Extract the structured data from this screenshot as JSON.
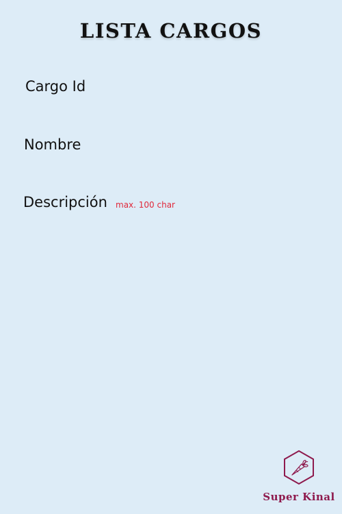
{
  "header": {
    "title": "LISTA CARGOS"
  },
  "form": {
    "fields": [
      {
        "label": "Cargo Id"
      },
      {
        "label": "Nombre"
      },
      {
        "label": "Descripción",
        "hint": "max. 100 char"
      }
    ]
  },
  "brand": {
    "name": "Super Kinal",
    "icon": "carrot-hexagon-icon"
  },
  "colors": {
    "background": "#ddecf7",
    "text": "#111111",
    "hint": "#e0283a",
    "brand": "#8e1a4d"
  }
}
